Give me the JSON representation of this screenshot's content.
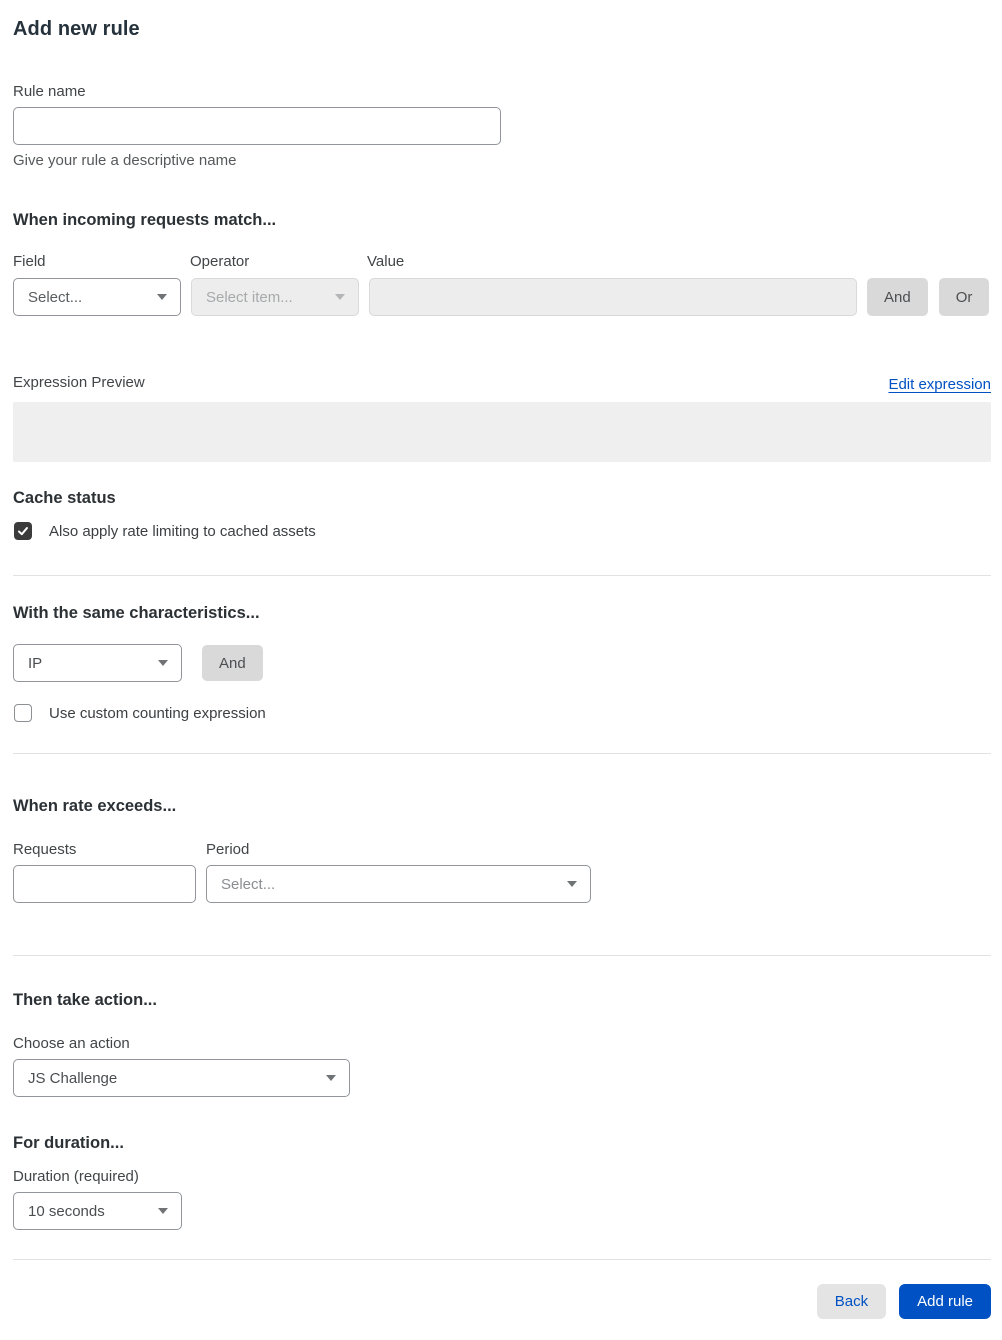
{
  "page": {
    "title": "Add new rule"
  },
  "colors": {
    "accent_blue": "#0051c3",
    "button_gray": "#d9d9d9",
    "disabled_bg": "#ededed",
    "checkbox_checked": "#3b3b3b",
    "divider": "#e2e2e2"
  },
  "rule_name": {
    "label": "Rule name",
    "value": "",
    "helper": "Give your rule a descriptive name"
  },
  "match_section": {
    "heading": "When incoming requests match...",
    "field": {
      "label": "Field",
      "value": "Select..."
    },
    "operator": {
      "label": "Operator",
      "value": "Select item..."
    },
    "value_field": {
      "label": "Value",
      "value": ""
    },
    "and_button": "And",
    "or_button": "Or",
    "expression_preview_label": "Expression Preview",
    "edit_expression_link": "Edit expression",
    "expression_value": ""
  },
  "cache_section": {
    "heading": "Cache status",
    "checkbox_label": "Also apply rate limiting to cached assets",
    "checked": true
  },
  "characteristics_section": {
    "heading": "With the same characteristics...",
    "select_value": "IP",
    "and_button": "And",
    "checkbox_label": "Use custom counting expression",
    "checked": false
  },
  "rate_section": {
    "heading": "When rate exceeds...",
    "requests": {
      "label": "Requests",
      "value": ""
    },
    "period": {
      "label": "Period",
      "value": "Select..."
    }
  },
  "action_section": {
    "heading": "Then take action...",
    "label": "Choose an action",
    "value": "JS Challenge"
  },
  "duration_section": {
    "heading": "For duration...",
    "label": "Duration (required)",
    "value": "10 seconds"
  },
  "footer": {
    "back_label": "Back",
    "add_rule_label": "Add rule"
  }
}
